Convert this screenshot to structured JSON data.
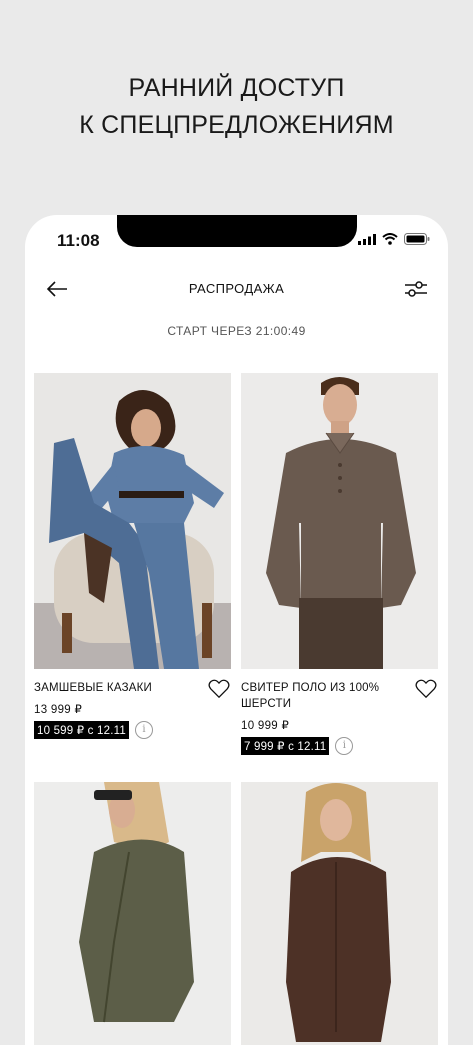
{
  "promo": {
    "line1": "РАННИЙ ДОСТУП",
    "line2": "К СПЕЦПРЕДЛОЖЕНИЯМ"
  },
  "status_bar": {
    "time": "11:08",
    "icons": [
      "signal-icon",
      "wifi-icon",
      "battery-icon"
    ]
  },
  "header": {
    "title": "РАСПРОДАЖА",
    "back_icon": "arrow-left-icon",
    "filter_icon": "filter-sliders-icon"
  },
  "countdown": "СТАРТ ЧЕРЕЗ 21:00:49",
  "products": [
    {
      "name": "ЗАМШЕВЫЕ КАЗАКИ",
      "price": "13 999 ₽",
      "sale": "10 599 ₽ с 12.11"
    },
    {
      "name": "СВИТЕР ПОЛО ИЗ 100% ШЕРСТИ",
      "price": "10 999 ₽",
      "sale": "7 999 ₽ с 12.11"
    },
    {
      "name": "",
      "price": "",
      "sale": ""
    },
    {
      "name": "",
      "price": "",
      "sale": ""
    }
  ],
  "info_glyph": "i"
}
